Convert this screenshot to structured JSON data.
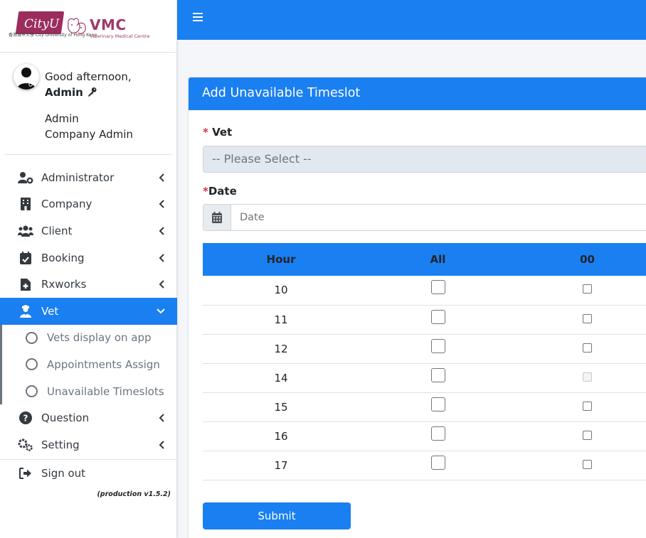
{
  "brand": {
    "cityu_text": "CityU",
    "cityu_sub": "香港城市大學 City University of Hong Kong",
    "vmc_text": "VMC",
    "vmc_sub": "Veterinary Medical Centre"
  },
  "user": {
    "greeting": "Good afternoon,",
    "name": "Admin",
    "role_line1": "Admin",
    "role_line2": "Company Admin"
  },
  "sidebar": {
    "items": [
      {
        "label": "Administrator",
        "icon": "user-cog-icon"
      },
      {
        "label": "Company",
        "icon": "building-icon"
      },
      {
        "label": "Client",
        "icon": "users-icon"
      },
      {
        "label": "Booking",
        "icon": "calendar-check-icon"
      },
      {
        "label": "Rxworks",
        "icon": "file-medical-icon"
      },
      {
        "label": "Vet",
        "icon": "user-nurse-icon"
      }
    ],
    "vet_sub": [
      {
        "label": "Vets display on app"
      },
      {
        "label": "Appointments Assign"
      },
      {
        "label": "Unavailable Timeslots"
      }
    ],
    "items2": [
      {
        "label": "Question",
        "icon": "question-circle-icon"
      },
      {
        "label": "Setting",
        "icon": "cogs-icon"
      }
    ],
    "signout": "Sign out",
    "version": "(production v1.5.2)"
  },
  "form": {
    "title": "Add Unavailable Timeslot",
    "vet_label": "Vet",
    "vet_placeholder": "-- Please Select --",
    "date_label": "Date",
    "date_placeholder": "Date",
    "required_mark": "*",
    "submit_label": "Submit"
  },
  "table": {
    "headers": [
      "Hour",
      "All",
      "00"
    ],
    "rows": [
      {
        "hour": "10",
        "disabled": false
      },
      {
        "hour": "11",
        "disabled": false
      },
      {
        "hour": "12",
        "disabled": false
      },
      {
        "hour": "14",
        "disabled": true
      },
      {
        "hour": "15",
        "disabled": false
      },
      {
        "hour": "16",
        "disabled": false
      },
      {
        "hour": "17",
        "disabled": false
      }
    ]
  },
  "colors": {
    "primary": "#1a7ff0",
    "brand": "#9b2d5c",
    "required": "#dc3545"
  }
}
